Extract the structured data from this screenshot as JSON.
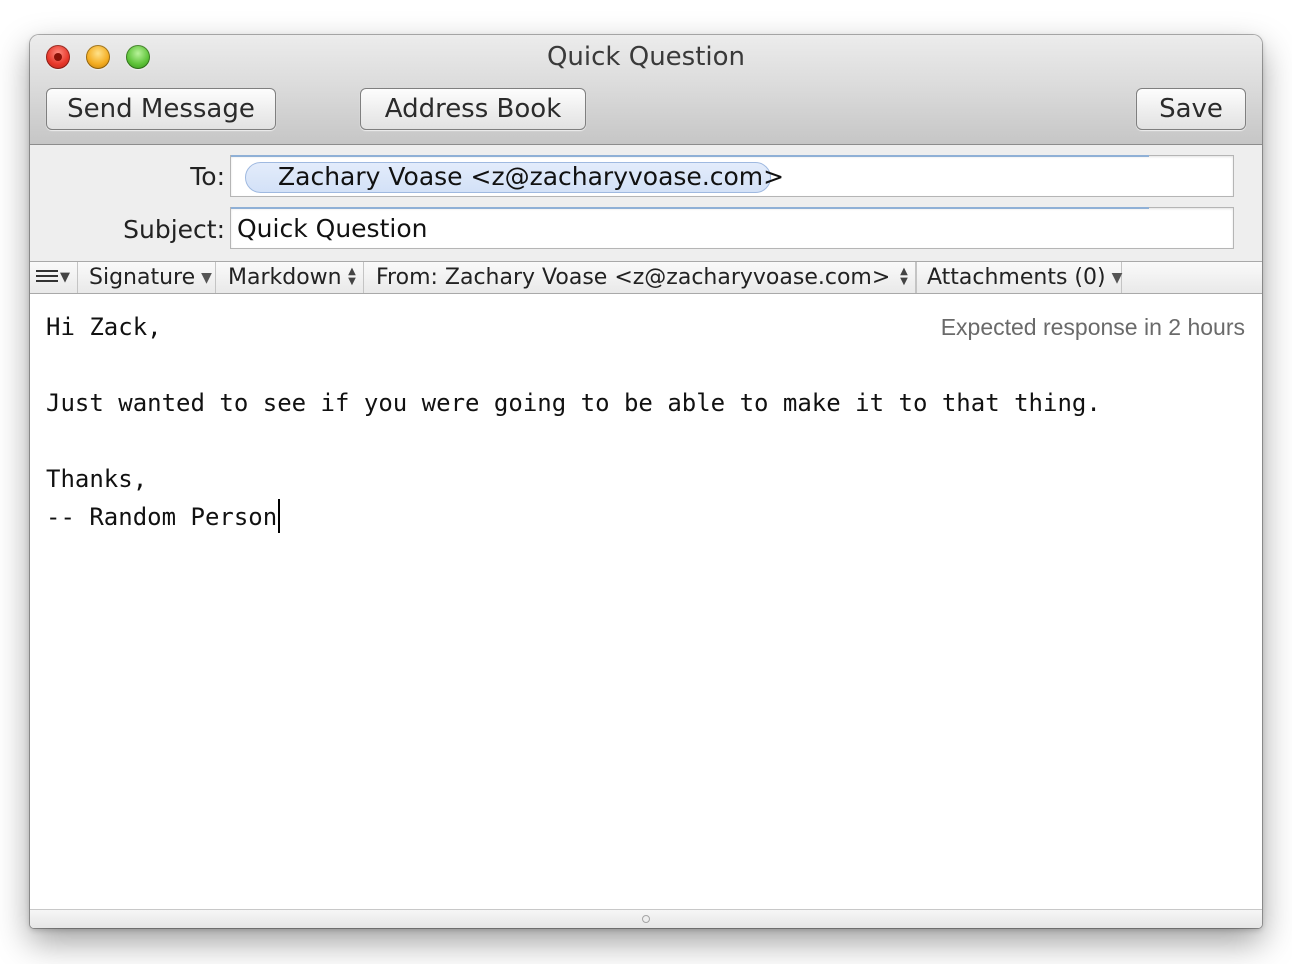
{
  "window": {
    "title": "Quick Question"
  },
  "toolbar": {
    "send_label": "Send Message",
    "address_book_label": "Address Book",
    "save_label": "Save"
  },
  "header": {
    "to_label": "To:",
    "to_recipient": "Zachary Voase <z@zacharyvoase.com>",
    "subject_label": "Subject:",
    "subject_value": "Quick Question"
  },
  "format_bar": {
    "signature_label": "Signature",
    "format_label": "Markdown",
    "from_label": "From: Zachary Voase <z@zacharyvoase.com>",
    "attachments_label": "Attachments (0)"
  },
  "body": {
    "text": "Hi Zack,\n\nJust wanted to see if you were going to be able to make it to that thing.\n\nThanks,\n-- Random Person",
    "expected_response": "Expected response in 2 hours"
  },
  "icons": {
    "menu": "hamburger-menu-icon",
    "dropdown": "triangle-down-icon",
    "stepper": "up-down-arrows-icon"
  },
  "colors": {
    "token_background": "#dbe6f9",
    "token_border": "#9fb9e0",
    "close_button": "#e8382b",
    "minimize_button": "#f4ad22",
    "zoom_button": "#5fc43a"
  }
}
